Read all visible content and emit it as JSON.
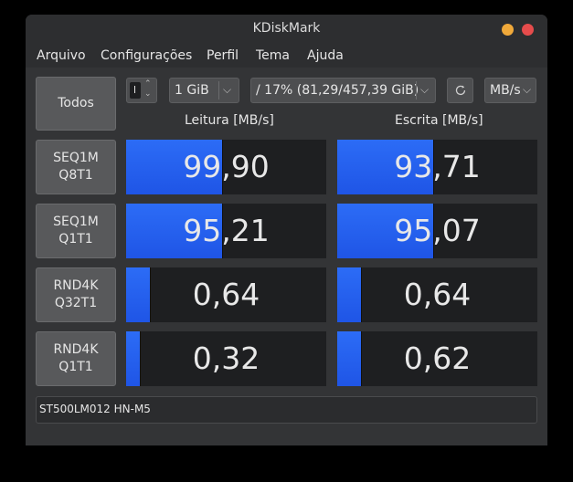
{
  "window": {
    "title": "KDiskMark"
  },
  "menu": [
    "Arquivo",
    "Configurações",
    "Perfil",
    "Tema",
    "Ajuda"
  ],
  "toolbar": {
    "all_button": "Todos",
    "runs_value": "",
    "size_value": "1 GiB",
    "drive_value": "/ 17% (81,29/457,39 GiB)",
    "unit_value": "MB/s"
  },
  "columns": {
    "read": "Leitura [MB/s]",
    "write": "Escrita [MB/s]"
  },
  "tests": [
    {
      "line1": "SEQ1M",
      "line2": "Q8T1",
      "read": "99,90",
      "write": "93,71",
      "read_fill": 0.48,
      "write_fill": 0.48
    },
    {
      "line1": "SEQ1M",
      "line2": "Q1T1",
      "read": "95,21",
      "write": "95,07",
      "read_fill": 0.48,
      "write_fill": 0.48
    },
    {
      "line1": "RND4K",
      "line2": "Q32T1",
      "read": "0,64",
      "write": "0,64",
      "read_fill": 0.12,
      "write_fill": 0.12
    },
    {
      "line1": "RND4K",
      "line2": "Q1T1",
      "read": "0,32",
      "write": "0,62",
      "read_fill": 0.07,
      "write_fill": 0.12
    }
  ],
  "device": "ST500LM012 HN-M5",
  "colors": {
    "bar": "#2a68f5",
    "cell_bg": "#1e1f21",
    "window_bg": "#333436"
  }
}
